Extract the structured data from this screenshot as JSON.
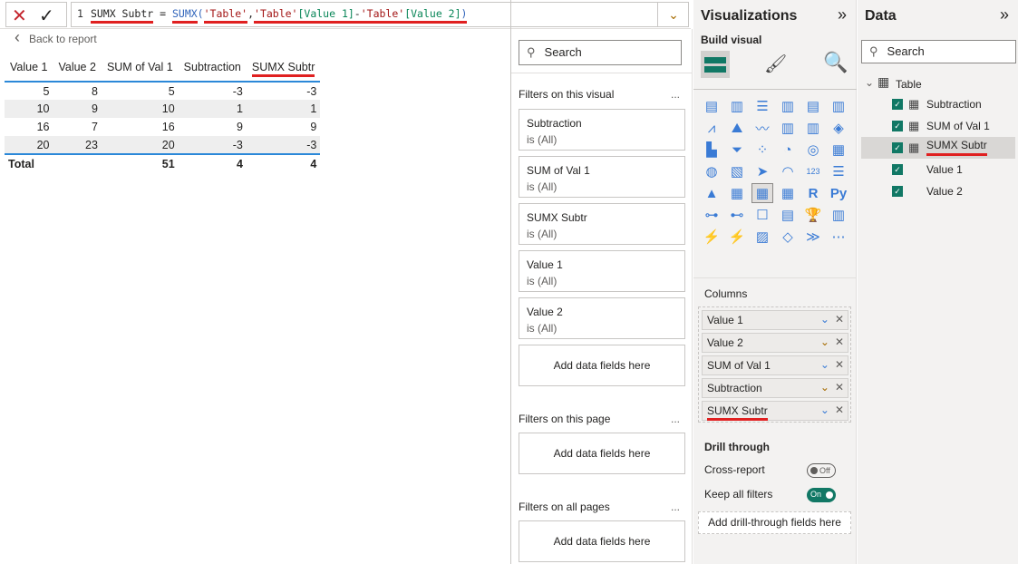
{
  "formula_bar": {
    "line_no": "1",
    "measure": "SUMX Subtr",
    "eq": " = ",
    "func": "SUMX",
    "open": "(",
    "arg1": "'Table'",
    "comma": ",",
    "t1": "'Table'",
    "c1": "[Value 1]",
    "minus": "-",
    "t2": "'Table'",
    "c2": "[Value 2]",
    "close": ")",
    "cancel_icon": "✕",
    "commit_icon": "✓",
    "expand_icon": "⌄"
  },
  "back_label": "Back to report",
  "table": {
    "headers": [
      "Value 1",
      "Value 2",
      "SUM of Val 1",
      "Subtraction",
      "SUMX Subtr"
    ],
    "rows": [
      [
        "5",
        "8",
        "5",
        "-3",
        "-3"
      ],
      [
        "10",
        "9",
        "10",
        "1",
        "1"
      ],
      [
        "16",
        "7",
        "16",
        "9",
        "9"
      ],
      [
        "20",
        "23",
        "20",
        "-3",
        "-3"
      ]
    ],
    "total": [
      "Total",
      "",
      "51",
      "4",
      "4"
    ]
  },
  "filters": {
    "search_placeholder": "Search",
    "on_visual": "Filters on this visual",
    "more": "...",
    "cards": [
      {
        "name": "Subtraction",
        "state": "is (All)"
      },
      {
        "name": "SUM of Val 1",
        "state": "is (All)"
      },
      {
        "name": "SUMX Subtr",
        "state": "is (All)"
      },
      {
        "name": "Value 1",
        "state": "is (All)"
      },
      {
        "name": "Value 2",
        "state": "is (All)"
      }
    ],
    "add": "Add data fields here",
    "on_page": "Filters on this page",
    "on_all": "Filters on all pages"
  },
  "viz": {
    "title": "Visualizations",
    "expand": "»",
    "build": "Build visual",
    "columns_label": "Columns",
    "columns": [
      "Value 1",
      "Value 2",
      "SUM of Val 1",
      "Subtraction",
      "SUMX Subtr"
    ],
    "drill": "Drill through",
    "cross": "Cross-report",
    "cross_state": "Off",
    "keep": "Keep all filters",
    "keep_state": "On",
    "drill_add": "Add drill-through fields here",
    "icons": [
      "▤",
      "▥",
      "☰",
      "▥",
      "▤",
      "▥",
      "⩘",
      "⛰",
      "〰",
      "▥",
      "▥",
      "◈",
      "▙",
      "⏷",
      "⁘",
      "◔",
      "◎",
      "▦",
      "◍",
      "▧",
      "➤",
      "◠",
      "123",
      "☰",
      "▲",
      "▦",
      "▦",
      "▦",
      "R",
      "Py",
      "⊶",
      "⊷",
      "☐",
      "▤",
      "🏆",
      "▥",
      "⚡",
      "⚡",
      "▨",
      "◇",
      "≫",
      "⋯"
    ]
  },
  "data": {
    "title": "Data",
    "expand": "»",
    "search_placeholder": "Search",
    "table": "Table",
    "fields": [
      {
        "name": "Subtraction",
        "calc": true
      },
      {
        "name": "SUM of Val 1",
        "calc": true
      },
      {
        "name": "SUMX Subtr",
        "calc": true
      },
      {
        "name": "Value 1",
        "calc": false
      },
      {
        "name": "Value 2",
        "calc": false
      }
    ]
  }
}
